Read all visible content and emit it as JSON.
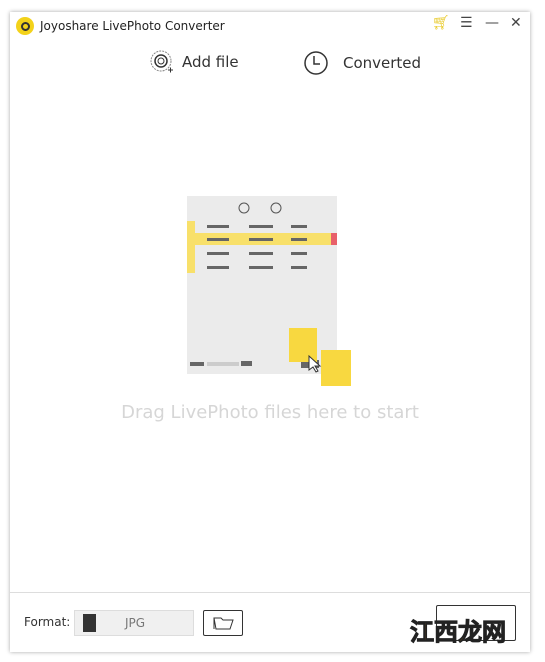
{
  "window": {
    "title": "Joyoshare LivePhoto Converter"
  },
  "toolbar": {
    "add_file": "Add file",
    "converted": "Converted"
  },
  "main": {
    "drop_hint": "Drag LivePhoto files here to start"
  },
  "footer": {
    "format_label": "Format:",
    "format_value": "JPG"
  },
  "watermark": "江西龙网",
  "colors": {
    "accent": "#f3d21a",
    "highlight": "#f8e06a"
  }
}
